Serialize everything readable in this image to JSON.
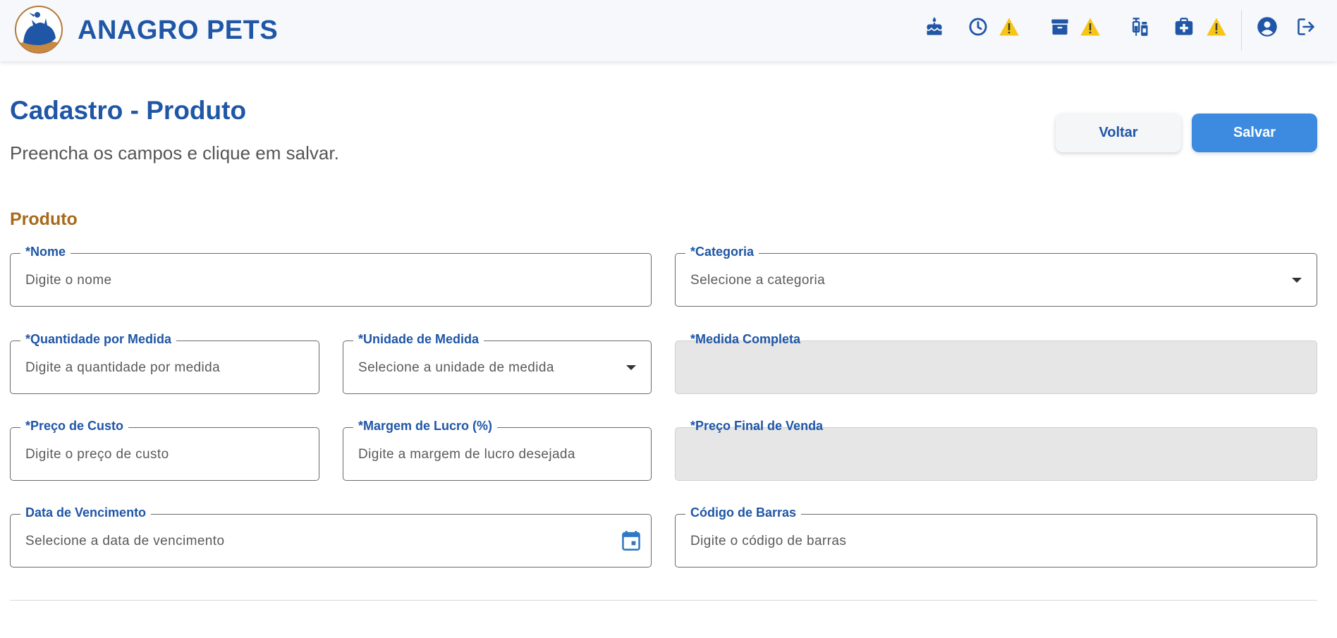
{
  "brand": {
    "name": "ANAGRO PETS"
  },
  "icons": {
    "birthday": "birthday-cake-icon",
    "clock": "clock-icon",
    "archive": "archive-icon",
    "vaccine": "vaccine-icon",
    "medkit": "medical-kit-icon",
    "warning": "warning-icon",
    "account": "account-icon",
    "logout": "logout-icon",
    "calendar": "calendar-icon",
    "dropdown": "chevron-down-icon"
  },
  "colors": {
    "primary": "#1f56a6",
    "accent": "#a86a1a",
    "button": "#3d8be0",
    "warning": "#f5c518"
  },
  "page": {
    "title": "Cadastro - Produto",
    "subtitle": "Preencha os campos e clique em salvar."
  },
  "actions": {
    "back_label": "Voltar",
    "save_label": "Salvar"
  },
  "section": {
    "title": "Produto"
  },
  "fields": {
    "nome": {
      "label": "*Nome",
      "placeholder": "Digite o nome"
    },
    "categoria": {
      "label": "*Categoria",
      "placeholder": "Selecione a categoria"
    },
    "quantidade": {
      "label": "*Quantidade por Medida",
      "placeholder": "Digite a quantidade por medida"
    },
    "unidade": {
      "label": "*Unidade de Medida",
      "placeholder": "Selecione a unidade de medida"
    },
    "medida_completa": {
      "label": "*Medida Completa",
      "placeholder": ""
    },
    "preco_custo": {
      "label": "*Preço de Custo",
      "placeholder": "Digite o preço de custo"
    },
    "margem": {
      "label": "*Margem de Lucro (%)",
      "placeholder": "Digite a margem de lucro desejada"
    },
    "preco_final": {
      "label": "*Preço Final de Venda",
      "placeholder": ""
    },
    "vencimento": {
      "label": "Data de Vencimento",
      "placeholder": "Selecione a data de vencimento"
    },
    "codigo_barras": {
      "label": "Código de Barras",
      "placeholder": "Digite o código de barras"
    }
  }
}
